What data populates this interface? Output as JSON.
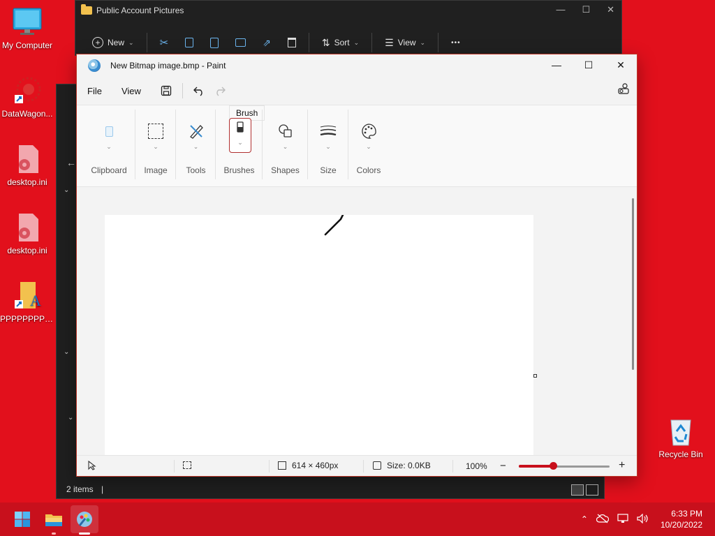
{
  "desktop": {
    "icons": [
      {
        "label": "My Computer"
      },
      {
        "label": "DataWagon..."
      },
      {
        "label": "desktop.ini"
      },
      {
        "label": "desktop.ini"
      },
      {
        "label": "РРРРРРРРРРРР..."
      },
      {
        "label": "Recycle Bin"
      }
    ]
  },
  "explorer_back": {
    "status_items": "2 items",
    "cursor": "|"
  },
  "explorer": {
    "title": "Public Account Pictures",
    "toolbar": {
      "new_label": "New",
      "sort_label": "Sort",
      "view_label": "View",
      "more_label": "•••"
    }
  },
  "paint": {
    "title": "New Bitmap image.bmp - Paint",
    "menu": {
      "file": "File",
      "view": "View"
    },
    "tooltip": "Brush",
    "groups": {
      "clipboard": "Clipboard",
      "image": "Image",
      "tools": "Tools",
      "brushes": "Brushes",
      "shapes": "Shapes",
      "size": "Size",
      "colors": "Colors"
    },
    "status": {
      "dimensions": "614 × 460px",
      "size": "Size: 0.0KB",
      "zoom": "100%",
      "zoom_fraction": 0.38
    }
  },
  "taskbar": {
    "time": "6:33 PM",
    "date": "10/20/2022"
  },
  "colors": {
    "desktop": "#e2101c",
    "taskbar": "#c8101c",
    "accent": "#c8101c"
  }
}
